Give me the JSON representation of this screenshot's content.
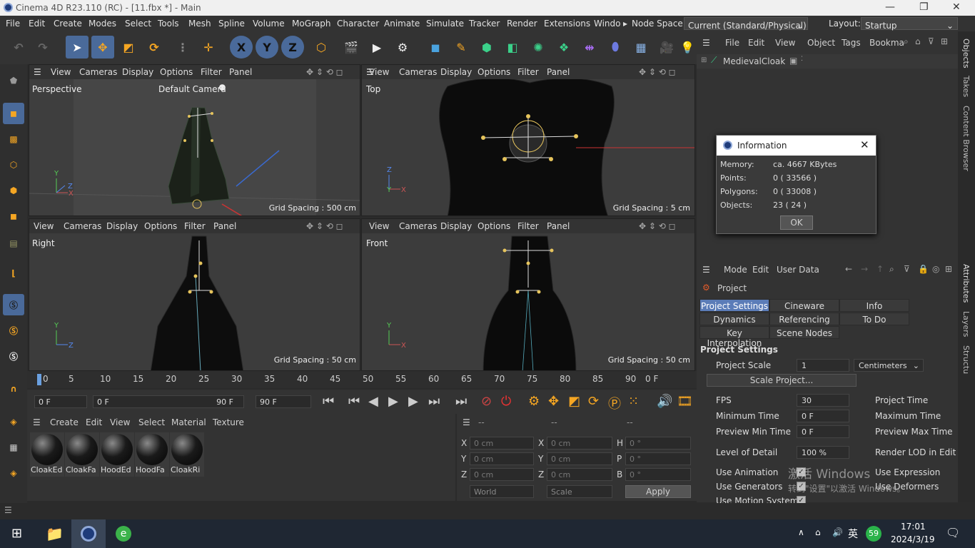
{
  "window": {
    "title": "Cinema 4D R23.110 (RC) - [11.fbx *] - Main"
  },
  "menu": {
    "items": [
      "File",
      "Edit",
      "Create",
      "Modes",
      "Select",
      "Tools",
      "Mesh",
      "Spline",
      "Volume",
      "MoGraph",
      "Character",
      "Animate",
      "Simulate",
      "Tracker",
      "Render",
      "Extensions",
      "Windo"
    ],
    "node_space_label": "Node Space:",
    "node_space_value": "Current (Standard/Physical)",
    "layout_label": "Layout:",
    "layout_value": "Startup"
  },
  "toolbar": {
    "x_label": "X",
    "y_label": "Y",
    "z_label": "Z"
  },
  "viewports": {
    "menu": [
      "View",
      "Cameras",
      "Display",
      "Options",
      "Filter",
      "Panel"
    ],
    "perspective": {
      "name": "Perspective",
      "camera": "Default Camera",
      "grid": "Grid Spacing : 500 cm"
    },
    "top": {
      "name": "Top",
      "grid": "Grid Spacing : 5 cm"
    },
    "right": {
      "name": "Right",
      "grid": "Grid Spacing : 50 cm"
    },
    "front": {
      "name": "Front",
      "grid": "Grid Spacing : 50 cm"
    }
  },
  "timeline": {
    "ticks": [
      "0",
      "5",
      "10",
      "15",
      "20",
      "25",
      "30",
      "35",
      "40",
      "45",
      "50",
      "55",
      "60",
      "65",
      "70",
      "75",
      "80",
      "85",
      "90"
    ],
    "end_label": "0 F",
    "current_frame": "0 F",
    "range_start": "0 F",
    "range_end": "90 F",
    "max_frame": "90 F"
  },
  "materials": {
    "menu": [
      "Create",
      "Edit",
      "View",
      "Select",
      "Material",
      "Texture"
    ],
    "items": [
      "CloakEd",
      "CloakFa",
      "HoodEd",
      "HoodFa",
      "CloakRi"
    ]
  },
  "coordinates": {
    "headers": [
      "--",
      "--",
      "--"
    ],
    "x_label": "X",
    "y_label": "Y",
    "z_label": "Z",
    "h_label": "H",
    "p_label": "P",
    "b_label": "B",
    "pos_x": "0 cm",
    "pos_y": "0 cm",
    "pos_z": "0 cm",
    "size_x": "0 cm",
    "size_y": "0 cm",
    "size_z": "0 cm",
    "rot_h": "0 °",
    "rot_p": "0 °",
    "rot_b": "0 °",
    "world": "World",
    "scale": "Scale",
    "apply": "Apply"
  },
  "objects": {
    "menu": [
      "File",
      "Edit",
      "View",
      "Object",
      "Tags",
      "Bookma"
    ],
    "item": "MedievalCloak"
  },
  "attributes": {
    "menu": [
      "Mode",
      "Edit",
      "User Data"
    ],
    "object": "Project",
    "tabs": [
      "Project Settings",
      "Cineware",
      "Info",
      "Dynamics",
      "Referencing",
      "To Do",
      "Key Interpolation",
      "Scene Nodes"
    ],
    "section": "Project Settings",
    "project_scale_label": "Project Scale",
    "project_scale_value": "1",
    "units": "Centimeters",
    "scale_project": "Scale Project...",
    "fps_label": "FPS",
    "fps_value": "30",
    "project_time_label": "Project Time",
    "min_time_label": "Minimum Time",
    "min_time_value": "0 F",
    "max_time_label": "Maximum Time",
    "preview_min_label": "Preview Min Time",
    "preview_min_value": "0 F",
    "preview_max_label": "Preview Max Time",
    "lod_label": "Level of Detail",
    "lod_value": "100 %",
    "render_lod_label": "Render LOD in Edit",
    "use_animation": "Use Animation",
    "use_expression": "Use Expression",
    "use_generators": "Use Generators",
    "use_deformers": "Use Deformers",
    "use_motion": "Use Motion System"
  },
  "dialog": {
    "title": "Information",
    "memory_label": "Memory:",
    "memory_value": "ca. 4667 KBytes",
    "points_label": "Points:",
    "points_value": "0 ( 33566 )",
    "polygons_label": "Polygons:",
    "polygons_value": "0 ( 33008 )",
    "objects_label": "Objects:",
    "objects_value": "23 ( 24 )",
    "ok": "OK"
  },
  "sidebar": {
    "objects": "Objects",
    "takes": "Takes",
    "content": "Content Browser",
    "attributes": "Attributes",
    "layers": "Layers",
    "structure": "Structu"
  },
  "watermark": {
    "activate": "激活 Windows",
    "settings": "转到\"设置\"以激活 Windows。"
  },
  "taskbar": {
    "ime": "英",
    "badge": "59",
    "time": "17:01",
    "date": "2024/3/19"
  }
}
